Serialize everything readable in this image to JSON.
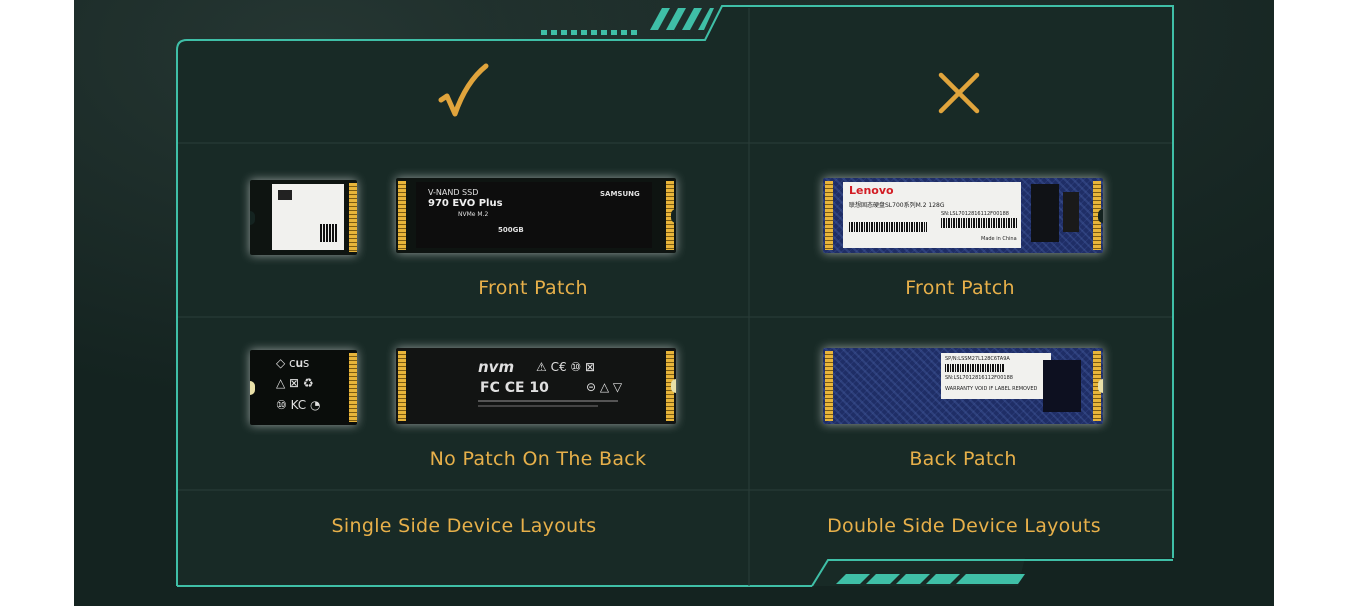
{
  "columns": {
    "left": {
      "mark": "check-mark",
      "row1_caption": "Front Patch",
      "row2_caption": "No Patch On The Back",
      "footer": "Single Side Device Layouts"
    },
    "right": {
      "mark": "cross-mark",
      "row1_caption": "Front Patch",
      "row2_caption": "Back Patch",
      "footer": "Double Side Device Layouts"
    }
  },
  "ssd_labels": {
    "samsung_front": {
      "line1": "V-NAND SSD",
      "model": "970 EVO Plus",
      "sub": "NVMe M.2",
      "capacity": "500GB",
      "brand": "SAMSUNG"
    },
    "samsung_back": {
      "logo": "nvm",
      "marks": "FC  CE  10"
    },
    "lenovo_front": {
      "brand": "Lenovo",
      "model": "联想固态硬盘SL700系列M.2 128G",
      "sn": "SN:LSL7012816112F00188",
      "made": "Made in China"
    },
    "lenovo_back": {
      "sn1": "SP/N:LSSM27L128C6TA9A",
      "sn2": "SN:LSL7012816112F00188",
      "warranty": "WARRANTY VOID IF LABEL REMOVED"
    }
  },
  "colors": {
    "background": "#142320",
    "panel": "#182a26",
    "border": "#3fbfa7",
    "accent_text": "#e7b04a",
    "grid_line": "#2a3d39"
  }
}
